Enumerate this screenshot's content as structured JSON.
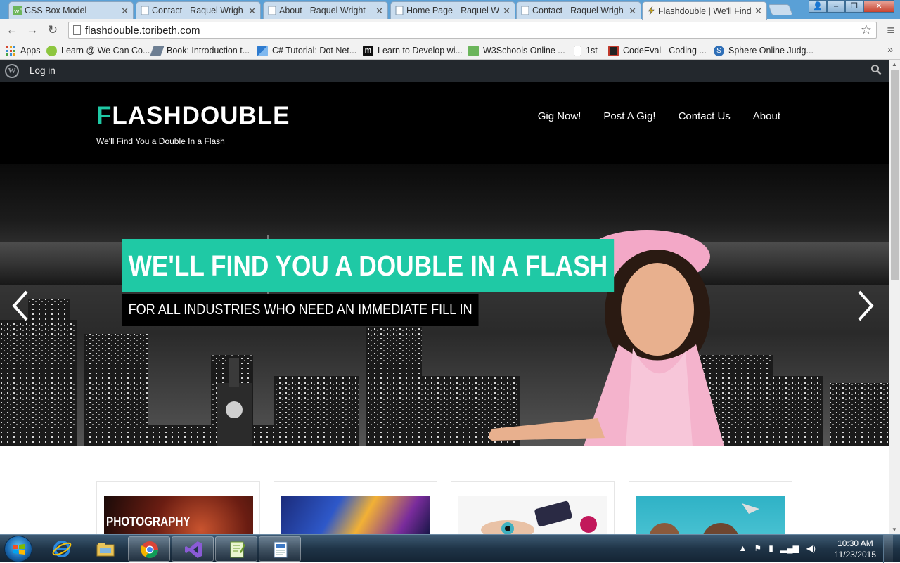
{
  "browser": {
    "tabs": [
      {
        "title": "CSS Box Model",
        "icon": "w3schools-icon",
        "color": "#6bb55b"
      },
      {
        "title": "Contact - Raquel Wrigh",
        "icon": "page-icon",
        "color": "#9db2c6"
      },
      {
        "title": "About - Raquel Wright",
        "icon": "page-icon",
        "color": "#9db2c6"
      },
      {
        "title": "Home Page - Raquel W",
        "icon": "page-icon",
        "color": "#9db2c6"
      },
      {
        "title": "Contact - Raquel Wrigh",
        "icon": "page-icon",
        "color": "#9db2c6"
      },
      {
        "title": "Flashdouble | We'll Find",
        "icon": "flash-icon",
        "color": "#e0b400",
        "active": true
      }
    ],
    "url": "flashdouble.toribeth.com",
    "bookmarks": [
      {
        "label": "Apps",
        "icon": "apps-grid-icon"
      },
      {
        "label": "Learn @ We Can Co...",
        "icon": "wecancode-icon"
      },
      {
        "label": "Book: Introduction t...",
        "icon": "book-icon"
      },
      {
        "label": "C# Tutorial: Dot Net...",
        "icon": "dotnet-icon"
      },
      {
        "label": "Learn to Develop wi...",
        "icon": "m-icon"
      },
      {
        "label": "W3Schools Online ...",
        "icon": "w3schools-icon"
      },
      {
        "label": "1st",
        "icon": "page-icon"
      },
      {
        "label": "CodeEval - Coding ...",
        "icon": "codeeval-icon"
      },
      {
        "label": "Sphere Online Judg...",
        "icon": "spoj-icon"
      }
    ],
    "bookmarks_more": "»"
  },
  "wp_admin_bar": {
    "logo": "W",
    "login_label": "Log in"
  },
  "site": {
    "title_first": "F",
    "title_rest": "LASHDOUBLE",
    "tagline": "We'll Find You a Double In a Flash",
    "nav": [
      "Gig Now!",
      "Post A Gig!",
      "Contact Us",
      "About"
    ],
    "accent_color": "#1fc9a5"
  },
  "hero": {
    "headline": "WE'LL FIND YOU A DOUBLE IN A FLASH",
    "subheadline": "FOR ALL INDUSTRIES WHO NEED AN IMMEDIATE FILL IN"
  },
  "cards": [
    {
      "label": "PHOTOGRAPHY",
      "theme": "photography"
    },
    {
      "label": "",
      "theme": "stage-lights"
    },
    {
      "label": "",
      "theme": "makeup"
    },
    {
      "label": "",
      "theme": "salon"
    }
  ],
  "taskbar": {
    "apps": [
      "internet-explorer-icon",
      "file-explorer-icon",
      "chrome-icon",
      "visual-studio-icon",
      "notepad-plus-icon",
      "wordpad-icon"
    ],
    "time": "10:30 AM",
    "date": "11/23/2015"
  }
}
